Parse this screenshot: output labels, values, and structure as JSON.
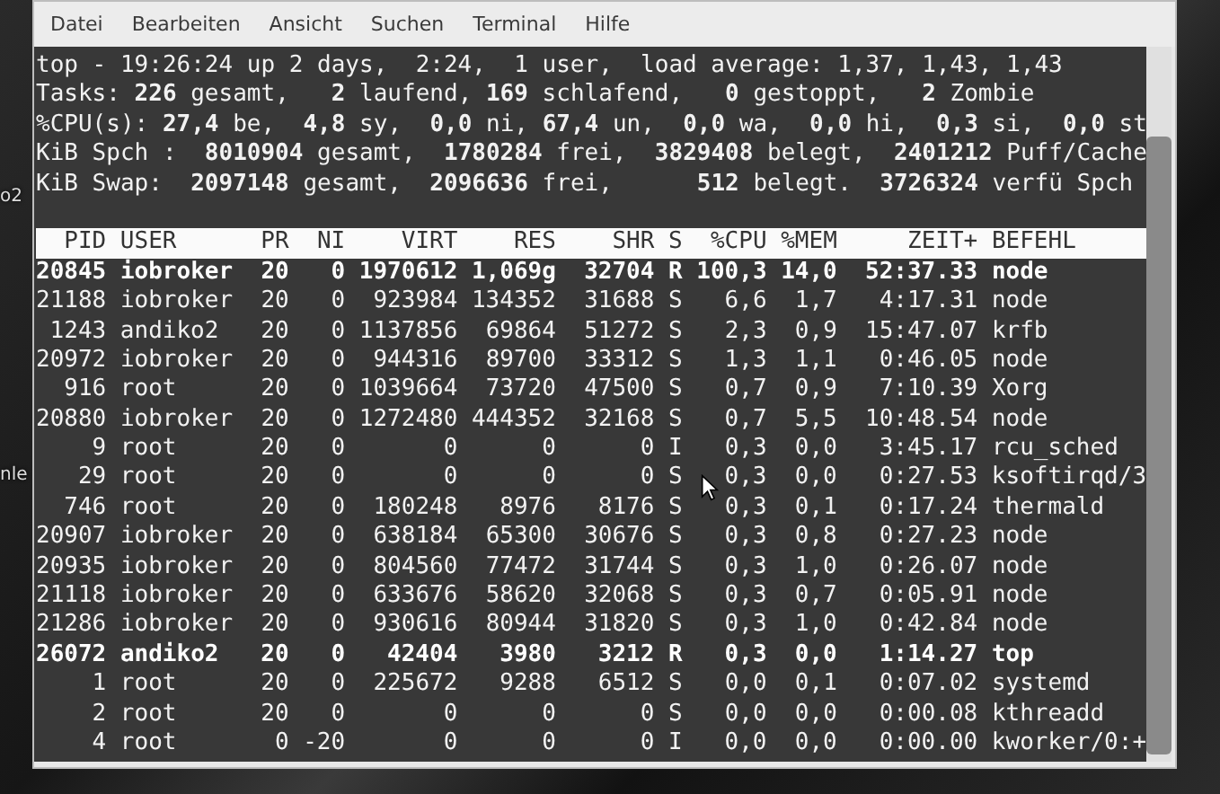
{
  "desktop_labels": [
    {
      "text": "o2"
    },
    {
      "text": "nle"
    }
  ],
  "menu": [
    "Datei",
    "Bearbeiten",
    "Ansicht",
    "Suchen",
    "Terminal",
    "Hilfe"
  ],
  "summary": [
    "top - 19:26:24 up 2 days,  2:24,  1 user,  load average: 1,37, 1,43, 1,43",
    "Tasks: **226** gesamt,   **2** laufend, **169** schlafend,   **0** gestoppt,   **2** Zombie",
    "%CPU(s): **27,4** be,  **4,8** sy,  **0,0** ni, **67,4** un,  **0,0** wa,  **0,0** hi,  **0,3** si,  **0,0** st",
    "KiB Spch :  **8010904** gesamt,  **1780284** frei,  **3829408** belegt,  **2401212** Puff/Cache",
    "KiB Swap:  **2097148** gesamt,  **2096636** frei,      **512** belegt.  **3726324** verfü Spch"
  ],
  "table": {
    "columns": [
      "PID",
      "USER",
      "PR",
      "NI",
      "VIRT",
      "RES",
      "SHR",
      "S",
      "%CPU",
      "%MEM",
      "ZEIT+",
      "BEFEHL"
    ],
    "rows": [
      {
        "bold": true,
        "cells": [
          "20845",
          "iobroker",
          "20",
          "0",
          "1970612",
          "1,069g",
          "32704",
          "R",
          "100,3",
          "14,0",
          "52:37.33",
          "node"
        ]
      },
      {
        "bold": false,
        "cells": [
          "21188",
          "iobroker",
          "20",
          "0",
          "923984",
          "134352",
          "31688",
          "S",
          "6,6",
          "1,7",
          "4:17.31",
          "node"
        ]
      },
      {
        "bold": false,
        "cells": [
          "1243",
          "andiko2",
          "20",
          "0",
          "1137856",
          "69864",
          "51272",
          "S",
          "2,3",
          "0,9",
          "15:47.07",
          "krfb"
        ]
      },
      {
        "bold": false,
        "cells": [
          "20972",
          "iobroker",
          "20",
          "0",
          "944316",
          "89700",
          "33312",
          "S",
          "1,3",
          "1,1",
          "0:46.05",
          "node"
        ]
      },
      {
        "bold": false,
        "cells": [
          "916",
          "root",
          "20",
          "0",
          "1039664",
          "73720",
          "47500",
          "S",
          "0,7",
          "0,9",
          "7:10.39",
          "Xorg"
        ]
      },
      {
        "bold": false,
        "cells": [
          "20880",
          "iobroker",
          "20",
          "0",
          "1272480",
          "444352",
          "32168",
          "S",
          "0,7",
          "5,5",
          "10:48.54",
          "node"
        ]
      },
      {
        "bold": false,
        "cells": [
          "9",
          "root",
          "20",
          "0",
          "0",
          "0",
          "0",
          "I",
          "0,3",
          "0,0",
          "3:45.17",
          "rcu_sched"
        ]
      },
      {
        "bold": false,
        "cells": [
          "29",
          "root",
          "20",
          "0",
          "0",
          "0",
          "0",
          "S",
          "0,3",
          "0,0",
          "0:27.53",
          "ksoftirqd/3"
        ]
      },
      {
        "bold": false,
        "cells": [
          "746",
          "root",
          "20",
          "0",
          "180248",
          "8976",
          "8176",
          "S",
          "0,3",
          "0,1",
          "0:17.24",
          "thermald"
        ]
      },
      {
        "bold": false,
        "cells": [
          "20907",
          "iobroker",
          "20",
          "0",
          "638184",
          "65300",
          "30676",
          "S",
          "0,3",
          "0,8",
          "0:27.23",
          "node"
        ]
      },
      {
        "bold": false,
        "cells": [
          "20935",
          "iobroker",
          "20",
          "0",
          "804560",
          "77472",
          "31744",
          "S",
          "0,3",
          "1,0",
          "0:26.07",
          "node"
        ]
      },
      {
        "bold": false,
        "cells": [
          "21118",
          "iobroker",
          "20",
          "0",
          "633676",
          "58620",
          "32068",
          "S",
          "0,3",
          "0,7",
          "0:05.91",
          "node"
        ]
      },
      {
        "bold": false,
        "cells": [
          "21286",
          "iobroker",
          "20",
          "0",
          "930616",
          "80944",
          "31820",
          "S",
          "0,3",
          "1,0",
          "0:42.84",
          "node"
        ]
      },
      {
        "bold": true,
        "cells": [
          "26072",
          "andiko2",
          "20",
          "0",
          "42404",
          "3980",
          "3212",
          "R",
          "0,3",
          "0,0",
          "1:14.27",
          "top"
        ]
      },
      {
        "bold": false,
        "cells": [
          "1",
          "root",
          "20",
          "0",
          "225672",
          "9288",
          "6512",
          "S",
          "0,0",
          "0,1",
          "0:07.02",
          "systemd"
        ]
      },
      {
        "bold": false,
        "cells": [
          "2",
          "root",
          "20",
          "0",
          "0",
          "0",
          "0",
          "S",
          "0,0",
          "0,0",
          "0:00.08",
          "kthreadd"
        ]
      },
      {
        "bold": false,
        "cells": [
          "4",
          "root",
          "0",
          "-20",
          "0",
          "0",
          "0",
          "I",
          "0,0",
          "0,0",
          "0:00.00",
          "kworker/0:+"
        ]
      }
    ]
  }
}
